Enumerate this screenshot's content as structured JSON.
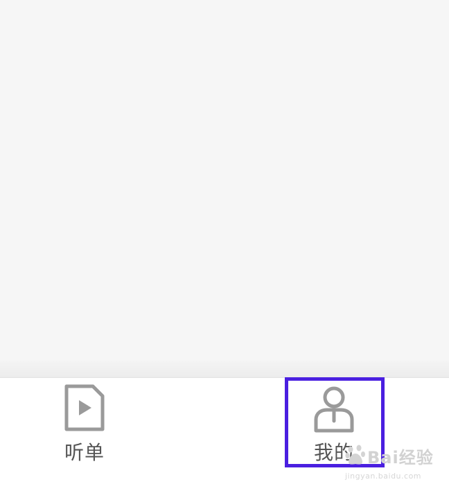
{
  "tabs": [
    {
      "id": "listen",
      "label": "听单",
      "icon": "play-document-icon"
    },
    {
      "id": "mine",
      "label": "我的",
      "icon": "user-profile-icon",
      "highlighted": true
    }
  ],
  "watermark": {
    "brand": "Bai经验",
    "url": "jingyan.baidu.com",
    "icon": "baidu-paw-icon"
  },
  "colors": {
    "icon_gray": "#9a9a9a",
    "label_gray": "#555555",
    "highlight": "#4a1fe0",
    "content_bg": "#f6f6f6"
  }
}
